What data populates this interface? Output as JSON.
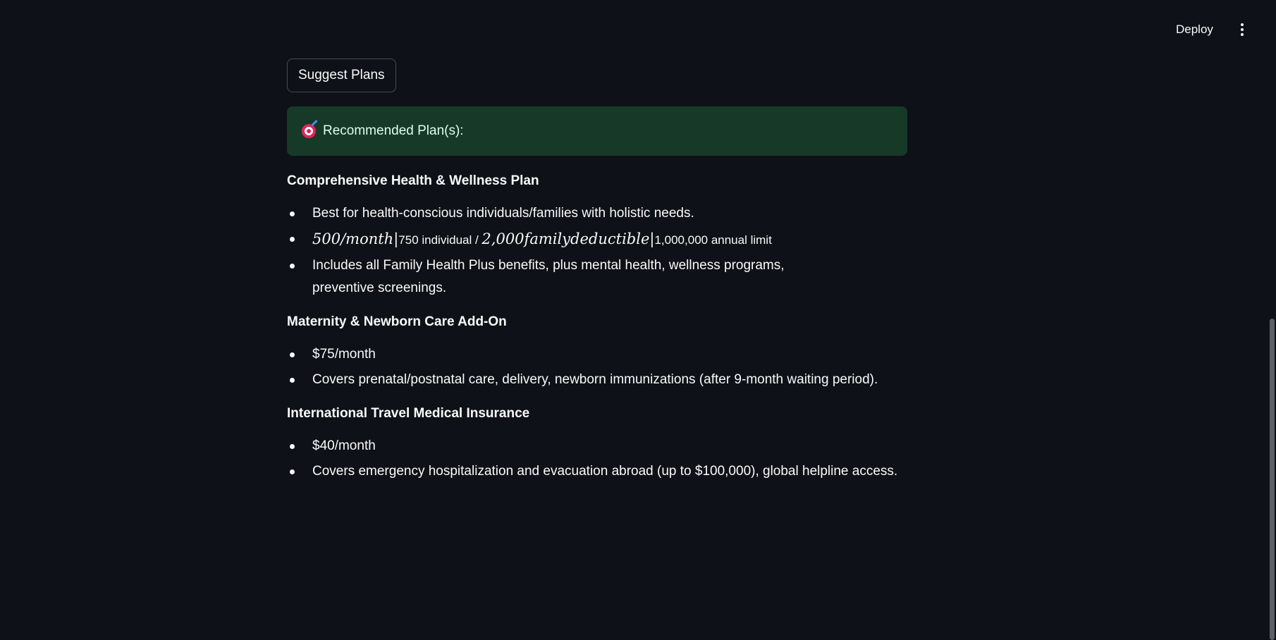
{
  "header": {
    "deploy_label": "Deploy",
    "menu_icon": "more-vertical-icon"
  },
  "actions": {
    "suggest_label": "Suggest Plans"
  },
  "success": {
    "icon": "target-icon",
    "text": "Recommended Plan(s):",
    "color": "#173928"
  },
  "plans": [
    {
      "title": "Comprehensive Health & Wellness Plan",
      "bullets": [
        "Best for health-conscious individuals/families with holistic needs.",
        {
          "math_1": "500/month",
          "sep_1": "|",
          "text_1": "750 individual / ",
          "math_2": "2,000",
          "math_3": "familydeductible",
          "sep_2": "|",
          "text_2": "1,000,000 annual limit"
        },
        "Includes all Family Health Plus benefits, plus mental health, wellness programs, preventive screenings."
      ]
    },
    {
      "title": "Maternity & Newborn Care Add-On",
      "bullets": [
        "$75/month",
        "Covers prenatal/postnatal care, delivery, newborn immunizations (after 9-month waiting period)."
      ]
    },
    {
      "title": "International Travel Medical Insurance",
      "bullets": [
        "$40/month",
        "Covers emergency hospitalization and evacuation abroad (up to $100,000), global helpline access."
      ]
    }
  ],
  "colors": {
    "background": "#0e1117",
    "text": "#fafafa",
    "success_bg": "#173928",
    "success_text": "#dffde9"
  }
}
